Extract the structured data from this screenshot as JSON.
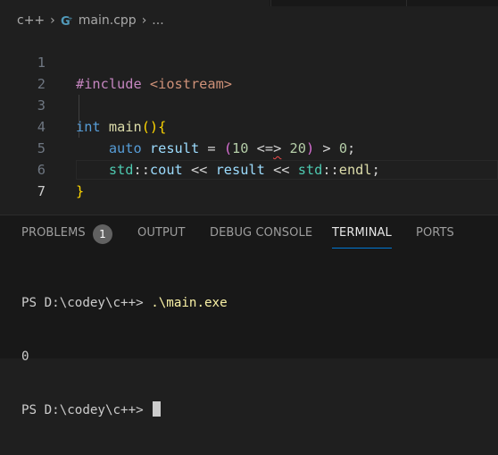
{
  "breadcrumb": {
    "folder": "c++",
    "file": "main.cpp",
    "more": "..."
  },
  "icons": {
    "file_icon": "cpp-file-icon",
    "chevron": "chevron-right-icon"
  },
  "editor": {
    "line_numbers": [
      "1",
      "2",
      "3",
      "4",
      "5",
      "6",
      "7"
    ],
    "active_line": "7",
    "lines": {
      "l1": {
        "directive": "#include",
        "space": " ",
        "header": "<iostream>"
      },
      "l3": {
        "type": "int",
        "space": " ",
        "fn": "main",
        "parens": "()",
        "brace": "{"
      },
      "l4": {
        "indent": "    ",
        "kw": "auto",
        "sp1": " ",
        "var": "result",
        "assign": " = ",
        "lp": "(",
        "n1": "10",
        "sp2": " ",
        "op_a": "<=",
        "op_b": ">",
        "sp3": " ",
        "n2": "20",
        "rp": ")",
        "gt": " > ",
        "n3": "0",
        "semi": ";"
      },
      "l5": {
        "indent": "    ",
        "ns1": "std",
        "c1": "::",
        "id1": "cout",
        "shl1": " << ",
        "var": "result",
        "shl2": " << ",
        "ns2": "std",
        "c2": "::",
        "id2": "endl",
        "semi": ";"
      },
      "l6": {
        "brace": "}"
      }
    }
  },
  "panel": {
    "tabs": [
      "PROBLEMS",
      "OUTPUT",
      "DEBUG CONSOLE",
      "TERMINAL",
      "PORTS"
    ],
    "problems_count": "1",
    "active_tab": "TERMINAL"
  },
  "terminal": {
    "line1_prompt": "PS D:\\codey\\c++> ",
    "line1_cmd": ".\\main.exe",
    "line2_output": "0",
    "line3_prompt": "PS D:\\codey\\c++> "
  },
  "colors": {
    "background": "#1f1f1f",
    "panel": "#181818",
    "accent": "#0078d4"
  }
}
